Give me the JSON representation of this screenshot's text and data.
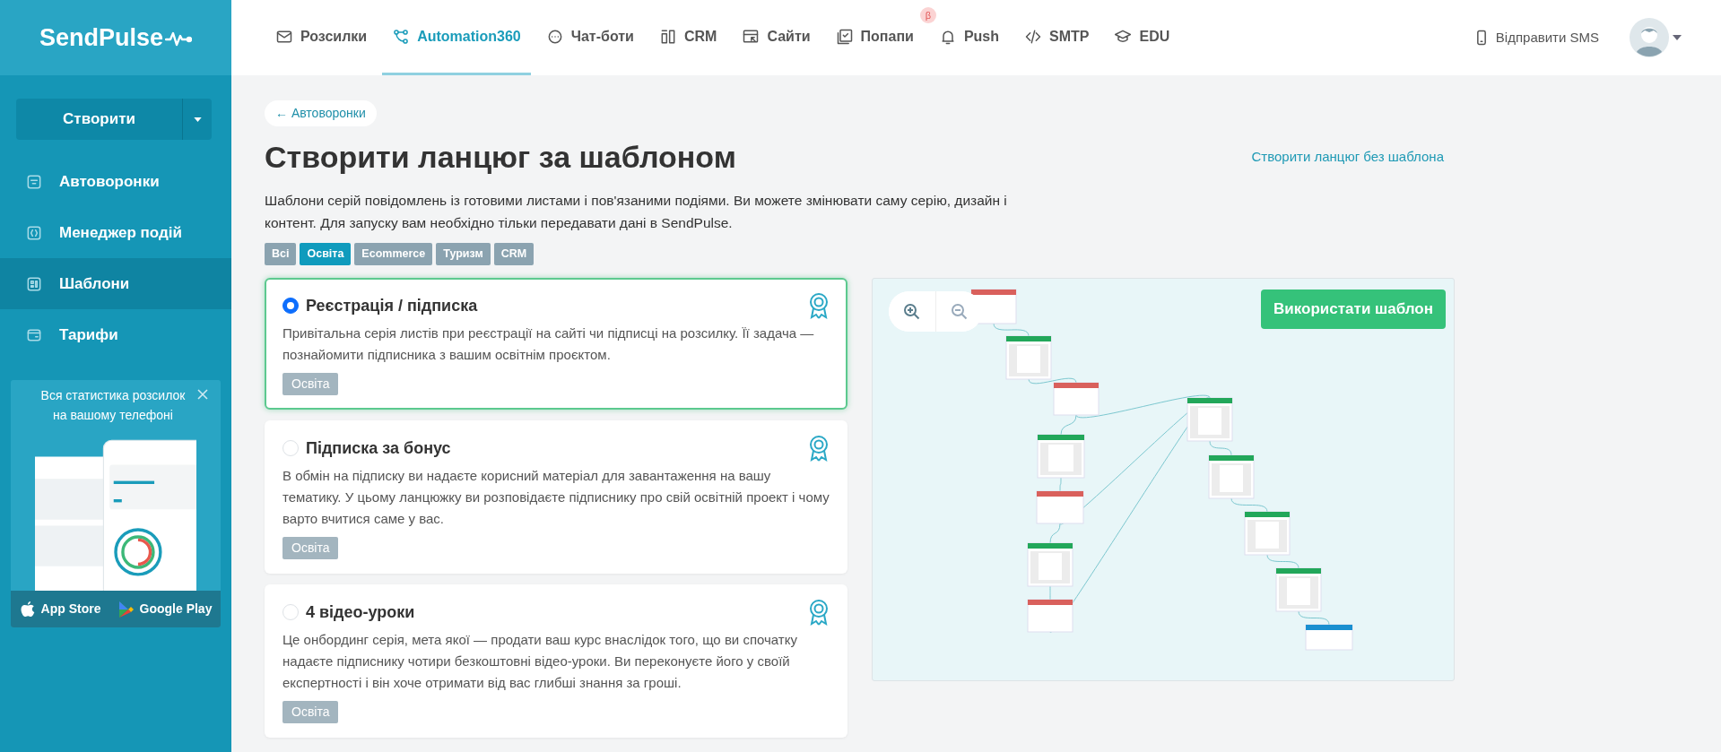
{
  "logo": {
    "text": "SendPulse"
  },
  "nav": [
    {
      "label": "Розсилки",
      "kind": "mail",
      "selected": false
    },
    {
      "label": "Automation360",
      "kind": "flow",
      "selected": true
    },
    {
      "label": "Чат-боти",
      "kind": "chat",
      "selected": false
    },
    {
      "label": "CRM",
      "kind": "crm",
      "selected": false
    },
    {
      "label": "Сайти",
      "kind": "site",
      "selected": false
    },
    {
      "label": "Попапи",
      "kind": "popup",
      "selected": false,
      "badge": "β"
    },
    {
      "label": "Push",
      "kind": "bell",
      "selected": false
    },
    {
      "label": "SMTP",
      "kind": "code",
      "selected": false
    },
    {
      "label": "EDU",
      "kind": "cap",
      "selected": false
    }
  ],
  "sms_link": "Відправити SMS",
  "sidebar": {
    "create_button": "Створити",
    "items": [
      {
        "label": "Автоворонки",
        "kind": "funnel",
        "selected": false
      },
      {
        "label": "Менеджер подій",
        "kind": "events",
        "selected": false
      },
      {
        "label": "Шаблони",
        "kind": "templates",
        "selected": true
      },
      {
        "label": "Тарифи",
        "kind": "wallet",
        "selected": false
      }
    ],
    "promo": {
      "title": "Вся статистика розсилок на вашому телефоні",
      "stores": [
        {
          "label": "App Store",
          "kind": "apple"
        },
        {
          "label": "Google Play",
          "kind": "play"
        }
      ]
    }
  },
  "back_link": "← Автоворонки",
  "title": "Створити ланцюг за шаблоном",
  "no_template_link": "Створити ланцюг без шаблона",
  "description": "Шаблони серій повідомлень із готовими листами і пов'язаними подіями. Ви можете змінювати саму серію, дизайн і контент. Для запуску вам необхідно тільки передавати дані в SendPulse.",
  "filters": [
    {
      "label": "Всі",
      "selected": false
    },
    {
      "label": "Освіта",
      "selected": true
    },
    {
      "label": "Ecommerce",
      "selected": false
    },
    {
      "label": "Туризм",
      "selected": false
    },
    {
      "label": "CRM",
      "selected": false
    }
  ],
  "templates": [
    {
      "title": "Реєстрація / підписка",
      "description": "Привітальна серія листів при реєстрації на сайті чи підписці на розсилку. Її задача — познайомити підписника з вашим освітнім проєктом.",
      "tag": "Освіта",
      "selected": true
    },
    {
      "title": "Підписка за бонус",
      "description": "В обмін на підписку ви надаєте корисний матеріал для завантаження на вашу тематику. У цьому ланцюжку ви розповідаєте підписнику про свій освітній проект і чому варто вчитися саме у вас.",
      "tag": "Освіта",
      "selected": false
    },
    {
      "title": "4 відео-уроки",
      "description": "Це онбординг серія, мета якої — продати ваш курс внаслідок того, що ви спочатку надаєте підписнику чотири безкоштовні відео-уроки. Ви переконуєте його у своїй експертності і він хоче отримати від вас глибші знання за гроші.",
      "tag": "Освіта",
      "selected": false
    }
  ],
  "preview": {
    "use_button": "Використати шаблон"
  }
}
